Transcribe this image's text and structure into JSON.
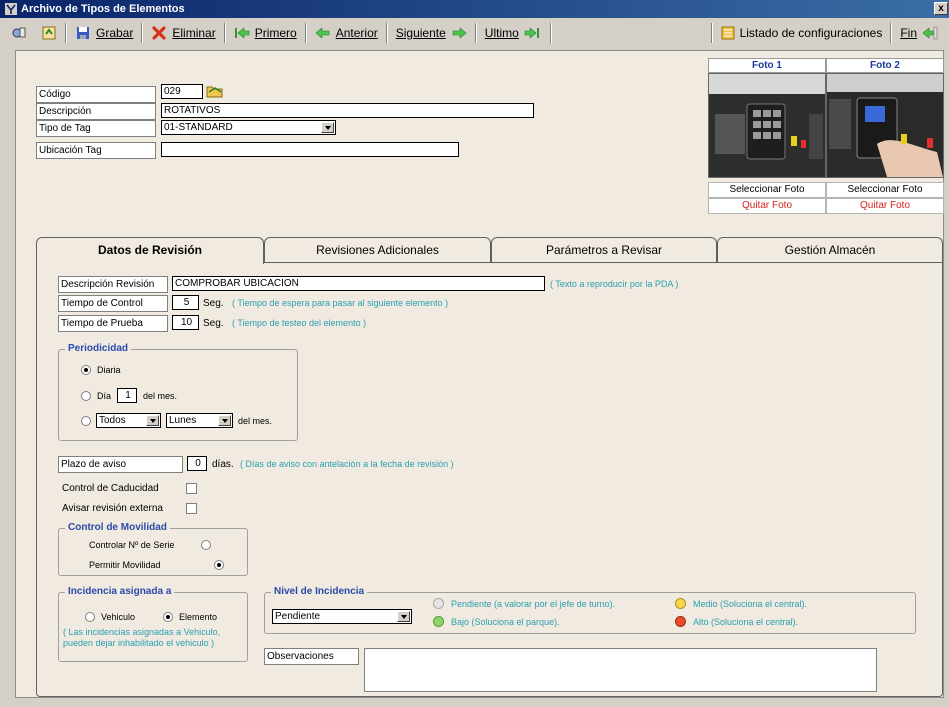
{
  "window": {
    "title": "Archivo de Tipos de Elementos",
    "close": "x"
  },
  "toolbar": {
    "grabar": "Grabar",
    "eliminar": "Eliminar",
    "primero": "Primero",
    "anterior": "Anterior",
    "siguiente": "Siguiente",
    "ultimo": "Ultimo",
    "listado": "Listado de configuraciones",
    "fin": "Fin"
  },
  "form": {
    "codigo_label": "Código",
    "codigo_value": "029",
    "descripcion_label": "Descripción",
    "descripcion_value": "ROTATIVOS",
    "tipo_tag_label": "Tipo de Tag",
    "tipo_tag_value": "01-STANDARD",
    "ubicacion_tag_label": "Ubicación Tag",
    "ubicacion_tag_value": ""
  },
  "photos": [
    {
      "title": "Foto 1",
      "select": "Seleccionar Foto",
      "remove": "Quitar Foto"
    },
    {
      "title": "Foto 2",
      "select": "Seleccionar Foto",
      "remove": "Quitar Foto"
    }
  ],
  "tabs": [
    "Datos de Revisión",
    "Revisiones Adicionales",
    "Parámetros a Revisar",
    "Gestión Almacén"
  ],
  "revision": {
    "desc_label": "Descripción Revisión",
    "desc_value": "COMPROBAR UBICACION",
    "desc_note": "( Texto a reproducir por la PDA )",
    "tiempo_control_label": "Tiempo de Control",
    "tiempo_control_value": "5",
    "seg": "Seg.",
    "tiempo_control_note": "( Tiempo de espera para pasar al siguiente elemento )",
    "tiempo_prueba_label": "Tiempo de Prueba",
    "tiempo_prueba_value": "10",
    "tiempo_prueba_note": "( Tiempo de testeo del elemento )"
  },
  "periodicidad": {
    "title": "Periodicidad",
    "diaria": "Diaria",
    "dia": "Día",
    "dia_value": "1",
    "del_mes": "del mes.",
    "todos": "Todos",
    "lunes": "Lunes",
    "del_mes2": "del mes."
  },
  "plazo": {
    "label": "Plazo de aviso",
    "value": "0",
    "unit": "días.",
    "note": "( Días de aviso con antelación a la fecha de revisión )"
  },
  "control_caducidad": "Control de Caducidad",
  "avisar_revision": "Avisar revisión externa",
  "movilidad": {
    "title": "Control de Movilidad",
    "serie": "Controlar Nº de Serie",
    "permitir": "Permitir Movilidad"
  },
  "incidencia": {
    "title": "Incidencia asignada a",
    "vehiculo": "Vehiculo",
    "elemento": "Elemento",
    "note": "( Las incidencias asignadas a Vehiculo, pueden dejar inhabilitado el vehiculo )"
  },
  "nivel": {
    "title": "Nivel de Incidencia",
    "value": "Pendiente",
    "pendiente": "Pendiente (a valorar por el jefe de turno).",
    "bajo": "Bajo (Soluciona el parque).",
    "medio": "Medio (Soluciona el central).",
    "alto": "Alto (Soluciona el central).",
    "colors": {
      "pendiente": "#e6e6e6",
      "bajo": "#8ed46a",
      "medio": "#f7d84a",
      "alto": "#e84a2a"
    }
  },
  "observaciones": "Observaciones"
}
